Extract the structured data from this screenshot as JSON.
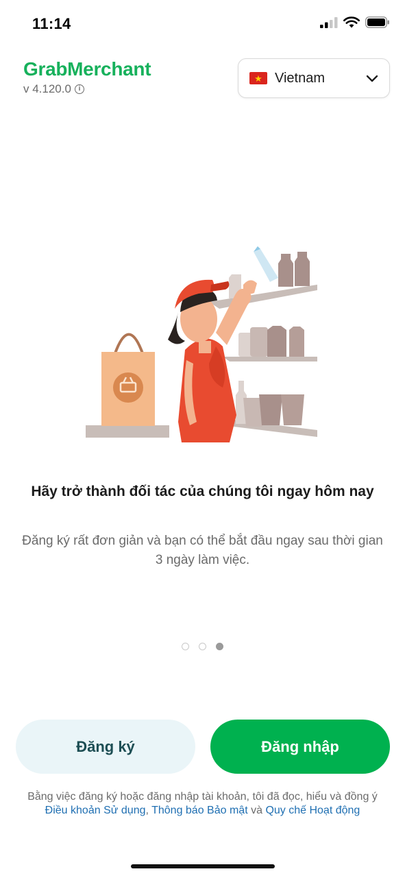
{
  "status_bar": {
    "time": "11:14"
  },
  "header": {
    "logo_text": "GrabMerchant",
    "version": "v 4.120.0",
    "country": {
      "label": "Vietnam",
      "flag_icon": "vietnam-flag-icon"
    }
  },
  "onboarding": {
    "headline": "Hãy trở thành đối tác của chúng tôi ngay hôm nay",
    "subtext": "Đăng ký rất đơn giản và bạn có thể bắt đầu ngay sau thời gian 3 ngày làm việc.",
    "page_count": 3,
    "active_page": 3
  },
  "actions": {
    "signup_label": "Đăng ký",
    "login_label": "Đăng nhập"
  },
  "legal": {
    "prefix": "Bằng việc đăng ký hoặc đăng nhập tài khoản, tôi đã đọc, hiểu và đồng ý ",
    "terms_link": "Điều khoản Sử dụng",
    "separator": ", ",
    "privacy_link": "Thông báo Bảo mật",
    "and": " và ",
    "code_link": "Quy chế Hoạt động"
  },
  "colors": {
    "brand_green": "#00b14f",
    "signup_bg": "#eaf5f8",
    "link_blue": "#1f6fb2"
  }
}
